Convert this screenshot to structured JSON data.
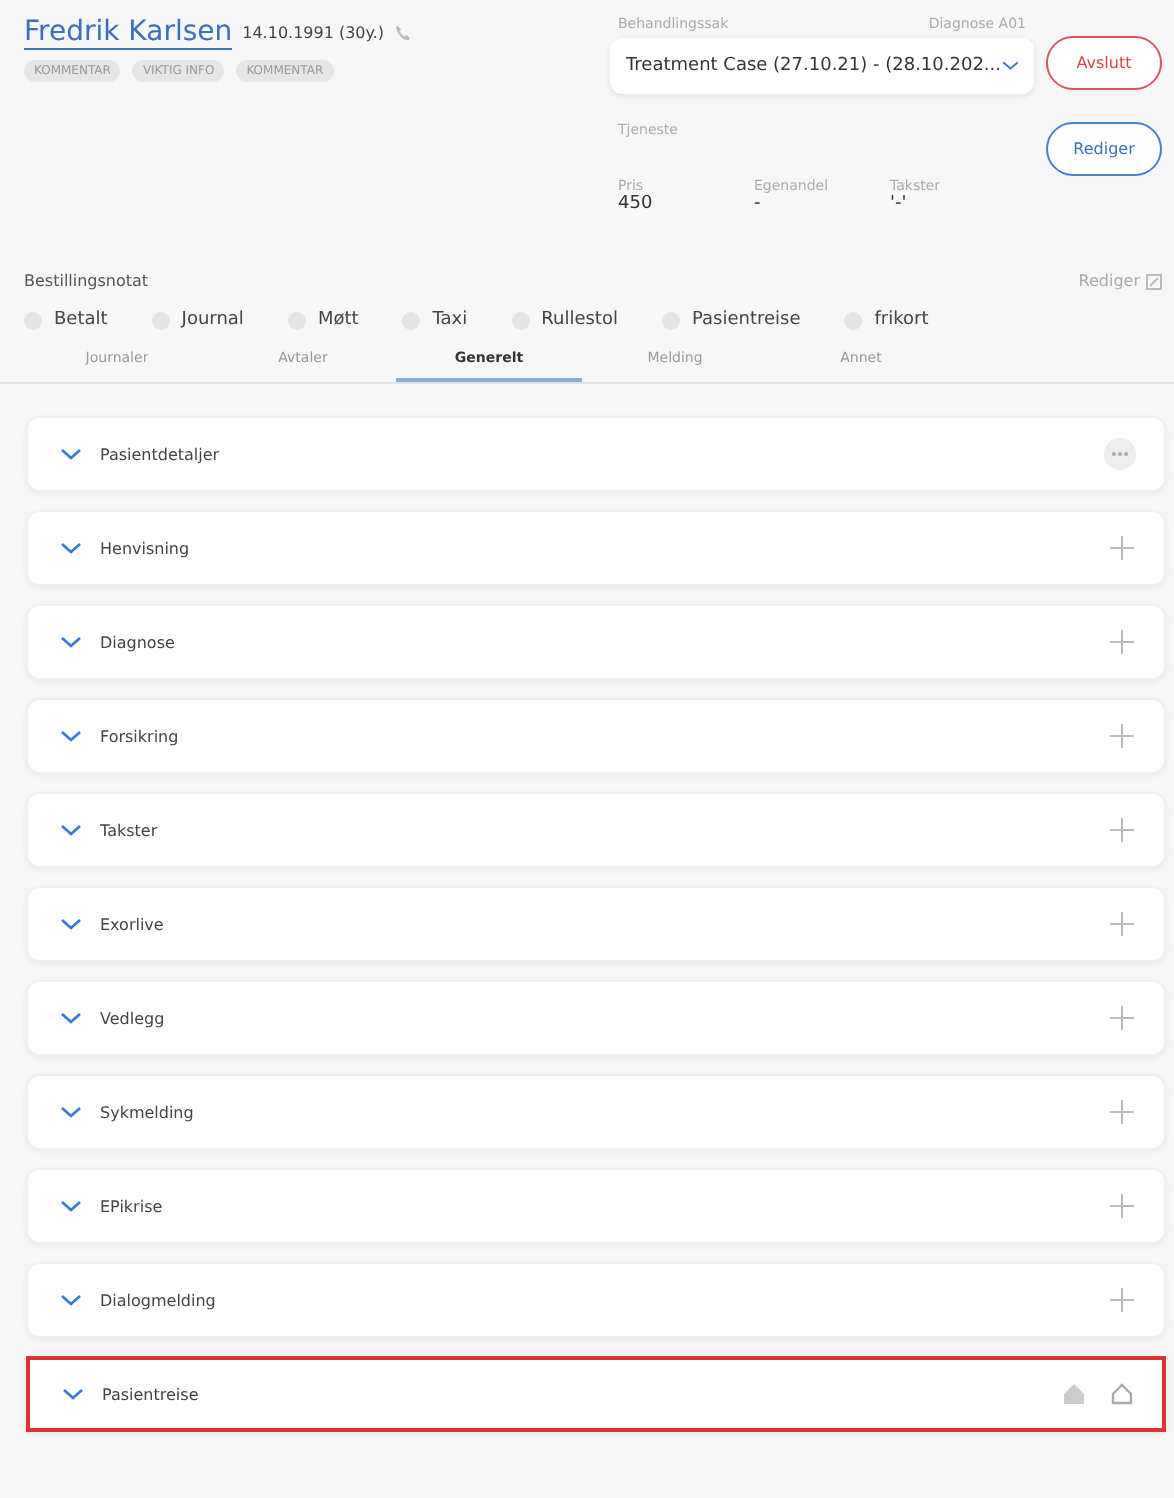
{
  "patient": {
    "name": "Fredrik Karlsen",
    "birth": "14.10.1991 (30y.)",
    "tags": [
      "KOMMENTAR",
      "VIKTIG INFO",
      "KOMMENTAR"
    ]
  },
  "case": {
    "label": "Behandlingssak",
    "diagnosis": "Diagnose A01",
    "value": "Treatment Case (27.10.21) - (28.10.202...",
    "service_label": "Tjeneste",
    "prices": [
      {
        "label": "Pris",
        "value": "450"
      },
      {
        "label": "Egenandel",
        "value": "-"
      },
      {
        "label": "Takster",
        "value": "'-'"
      }
    ]
  },
  "buttons": {
    "close": "Avslutt",
    "edit": "Rediger"
  },
  "note": {
    "label": "Bestillingsnotat",
    "edit": "Rediger"
  },
  "flags": [
    {
      "label": "Betalt",
      "checked": false
    },
    {
      "label": "Journal",
      "checked": false
    },
    {
      "label": "Møtt",
      "checked": false
    },
    {
      "label": "Taxi",
      "checked": false
    },
    {
      "label": "Rullestol",
      "checked": false
    },
    {
      "label": "Pasientreise",
      "checked": false
    },
    {
      "label": "frikort",
      "checked": false
    }
  ],
  "tabs": [
    {
      "label": "Journaler",
      "selected": false
    },
    {
      "label": "Avtaler",
      "selected": false
    },
    {
      "label": "Generelt",
      "selected": true
    },
    {
      "label": "Melding",
      "selected": false
    },
    {
      "label": "Annet",
      "selected": false
    }
  ],
  "sections": [
    {
      "title": "Pasientdetaljer",
      "kind": "more",
      "highlighted": false
    },
    {
      "title": "Henvisning",
      "kind": "add",
      "highlighted": false
    },
    {
      "title": "Diagnose",
      "kind": "add",
      "highlighted": false
    },
    {
      "title": "Forsikring",
      "kind": "add",
      "highlighted": false
    },
    {
      "title": "Takster",
      "kind": "add",
      "highlighted": false
    },
    {
      "title": "Exorlive",
      "kind": "add",
      "highlighted": false
    },
    {
      "title": "Vedlegg",
      "kind": "add",
      "highlighted": false
    },
    {
      "title": "Sykmelding",
      "kind": "add",
      "highlighted": false
    },
    {
      "title": "EPikrise",
      "kind": "add",
      "highlighted": false
    },
    {
      "title": "Dialogmelding",
      "kind": "add",
      "highlighted": false
    },
    {
      "title": "Pasientreise",
      "kind": "travel",
      "highlighted": true
    }
  ]
}
